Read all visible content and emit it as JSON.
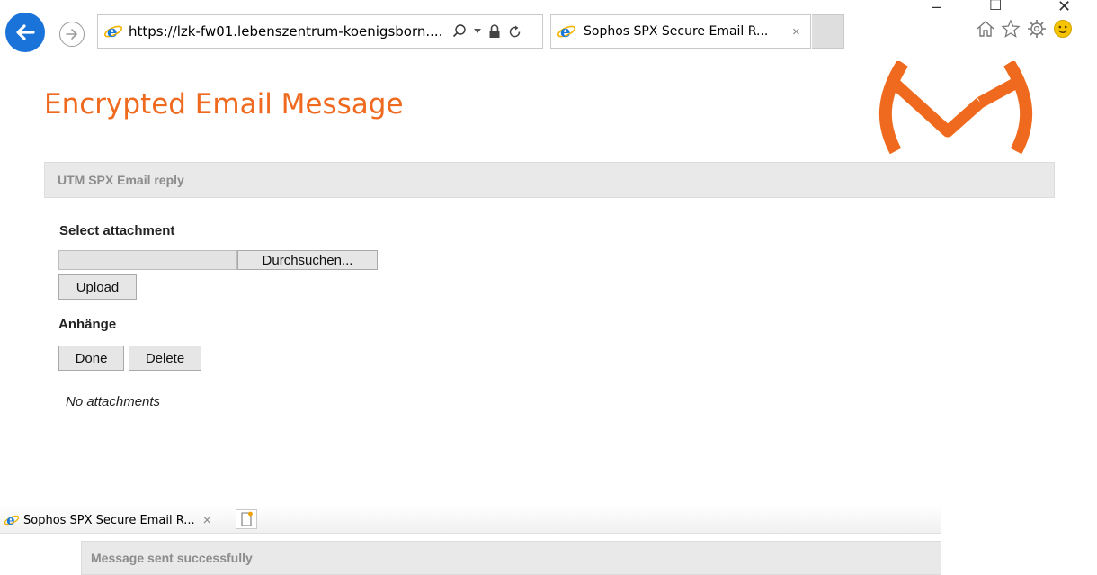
{
  "browser": {
    "address": "https://lzk-fw01.lebenszentrum-koenigsborn....",
    "tab_title": "Sophos SPX Secure Email R...",
    "tab_close": "×",
    "window_controls": [
      "–",
      "☐",
      "✕"
    ],
    "toolbar_icons": [
      "home-icon",
      "favorites-star-icon",
      "settings-gear-icon",
      "smiley-feedback-icon"
    ],
    "accent_color": "#1a73d8"
  },
  "page": {
    "title": "Encrypted Email Message",
    "title_color": "#ef6a1e",
    "section_header": "UTM SPX Email reply",
    "select_attachment_label": "Select attachment",
    "browse_button": "Durchsuchen...",
    "upload_button": "Upload",
    "attachments_label": "Anhänge",
    "done_button": "Done",
    "delete_button": "Delete",
    "no_attachments": "No attachments"
  },
  "second_window": {
    "tab_title": "Sophos SPX Secure Email R...",
    "tab_close": "×",
    "status_message": "Message sent successfully"
  }
}
